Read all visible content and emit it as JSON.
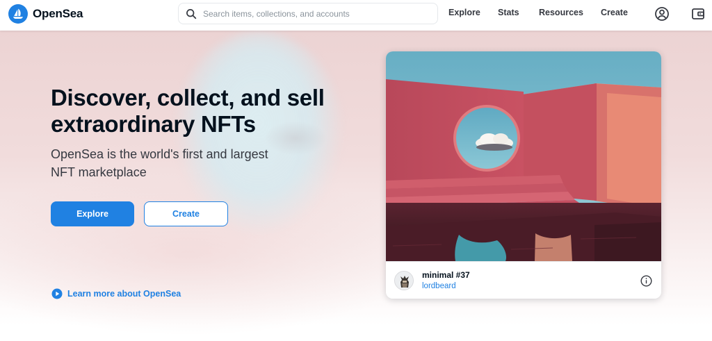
{
  "header": {
    "brand": "OpenSea",
    "search": {
      "placeholder": "Search items, collections, and accounts",
      "value": ""
    },
    "nav": {
      "explore": "Explore",
      "stats": "Stats",
      "resources": "Resources",
      "create": "Create"
    },
    "icons": {
      "profile": "account-circle-icon",
      "wallet": "wallet-icon",
      "search": "search-icon"
    }
  },
  "hero": {
    "title": "Discover, collect, and sell extraordinary NFTs",
    "subtitle": "OpenSea is the world's first and largest NFT marketplace",
    "primary_button": "Explore",
    "secondary_button": "Create",
    "learn_more": "Learn more about OpenSea"
  },
  "featured": {
    "item_name": "minimal #37",
    "creator": "lordbeard"
  },
  "colors": {
    "accent": "#2081e2",
    "text_primary": "#04111d",
    "text_secondary": "#353840"
  }
}
